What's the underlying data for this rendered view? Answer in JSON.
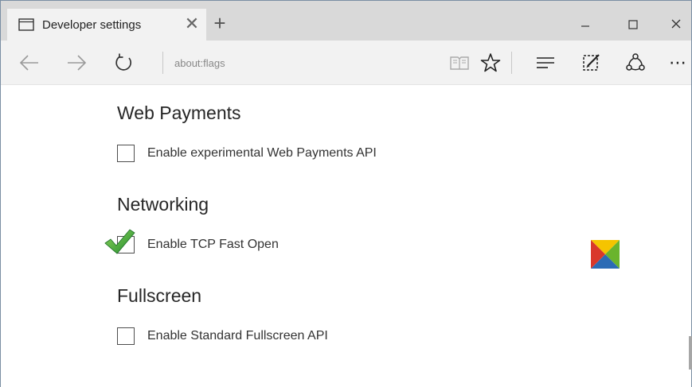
{
  "tab": {
    "title": "Developer settings",
    "close_glyph": "✕",
    "new_tab_glyph": "+"
  },
  "window_controls": {
    "minimize": "—",
    "maximize": "☐",
    "close": "✕"
  },
  "navbar": {
    "address": "about:flags",
    "icons": [
      "back-icon",
      "forward-icon",
      "refresh-icon",
      "reading-view-icon",
      "favorites-star-icon",
      "hub-icon",
      "web-note-icon",
      "share-icon",
      "more-icon"
    ],
    "more_glyph": "⋯"
  },
  "sections": [
    {
      "title": "Web Payments",
      "option": {
        "label": "Enable experimental Web Payments API",
        "checked": false
      }
    },
    {
      "title": "Networking",
      "option": {
        "label": "Enable TCP Fast Open",
        "checked": true
      }
    },
    {
      "title": "Fullscreen",
      "option": {
        "label": "Enable Standard Fullscreen API",
        "checked": false
      }
    }
  ],
  "colors": {
    "tabstrip_bg": "#d9d9d9",
    "navbar_bg": "#f2f2f2",
    "checkmark_green": "#2e9e3b",
    "logo_red": "#d9382b",
    "logo_green": "#6ab42d",
    "logo_yellow": "#f5c400",
    "logo_blue": "#2c6bb5"
  }
}
